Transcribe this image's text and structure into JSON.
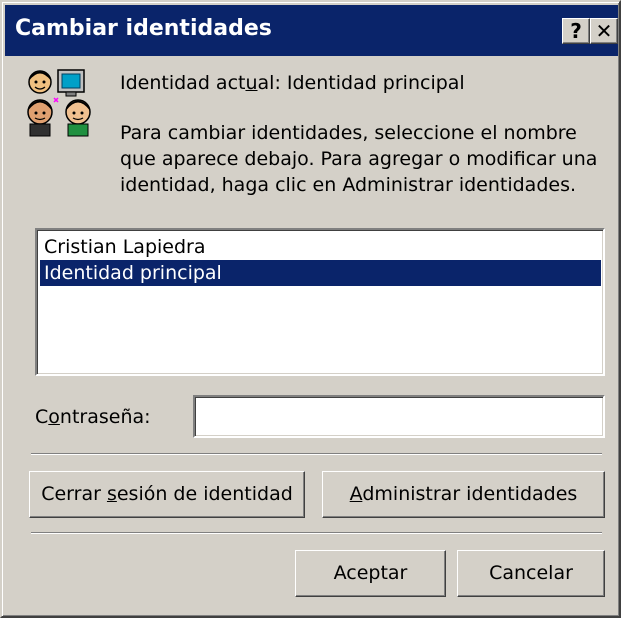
{
  "window": {
    "title": "Cambiar identidades",
    "help_glyph": "?",
    "close_glyph": "✕"
  },
  "header": {
    "current_identity_pre": "Identidad act",
    "current_identity_ul": "u",
    "current_identity_post": "al: Identidad principal",
    "instructions": [
      "Para cambiar identidades, seleccione el nombre",
      "que aparece debajo. Para agregar o modificar una",
      "identidad, haga clic en Administrar identidades."
    ],
    "icon": "identities-icon"
  },
  "identities": {
    "items": [
      {
        "label": "Cristian Lapiedra",
        "selected": false
      },
      {
        "label": "Identidad principal",
        "selected": true
      }
    ]
  },
  "password": {
    "label_pre": "C",
    "label_ul": "o",
    "label_post": "ntraseña:",
    "value": ""
  },
  "buttons": {
    "logout_pre": "Cerrar ",
    "logout_ul": "s",
    "logout_post": "esión de identidad",
    "manage_ul": "A",
    "manage_post": "dministrar identidades",
    "ok": "Aceptar",
    "cancel": "Cancelar"
  },
  "colors": {
    "titlebar": "#0a246a",
    "selection": "#0a246a",
    "face": "#d4d0c8"
  }
}
